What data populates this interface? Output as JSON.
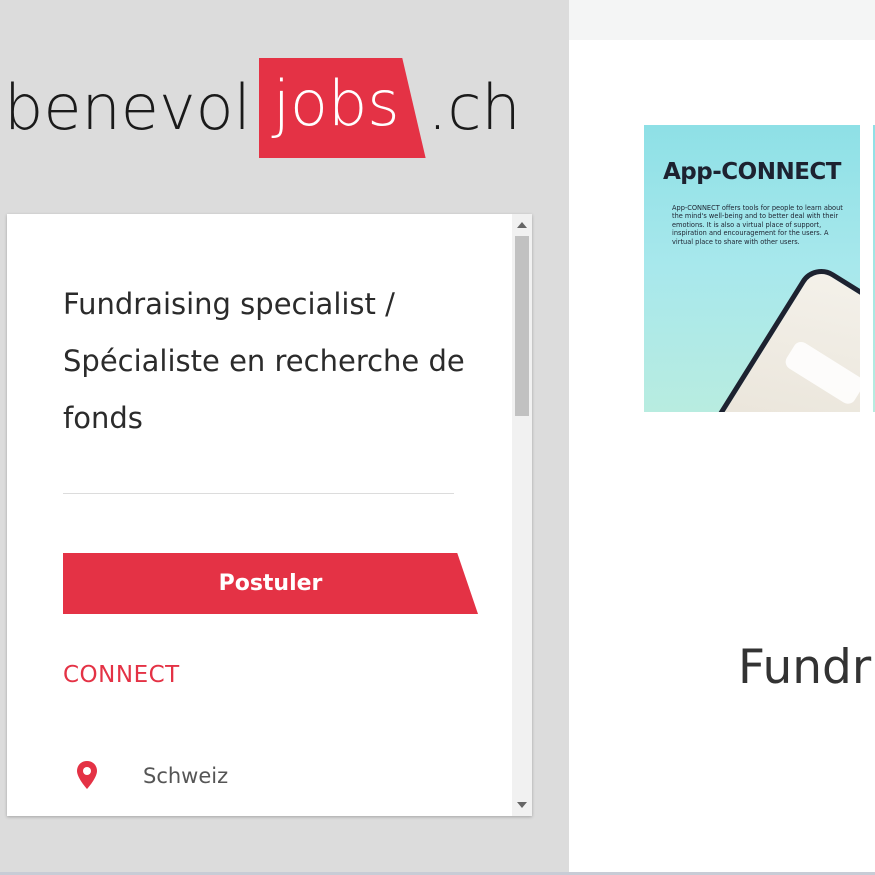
{
  "logo": {
    "part1": "benevol",
    "part2": "jobs",
    "part3": ".ch"
  },
  "job": {
    "title": "Fundraising specialist / Spécialiste en recherche de fonds",
    "apply_label": "Postuler",
    "company": "CONNECT",
    "location": "Schweiz"
  },
  "promo": {
    "title": "App-CONNECT",
    "text": "App-CONNECT offers tools for people to learn about the mind's well-being and to better deal with their emotions. It is also a virtual place of support, inspiration and encouragement for the users. A virtual place to share with other users."
  },
  "main": {
    "heading": "Fundr"
  },
  "colors": {
    "brand_red": "#e43245",
    "left_bg": "#dcdcdc",
    "promo_bg": "#8ee0e6"
  },
  "icons": {
    "location": "location-pin-icon"
  }
}
